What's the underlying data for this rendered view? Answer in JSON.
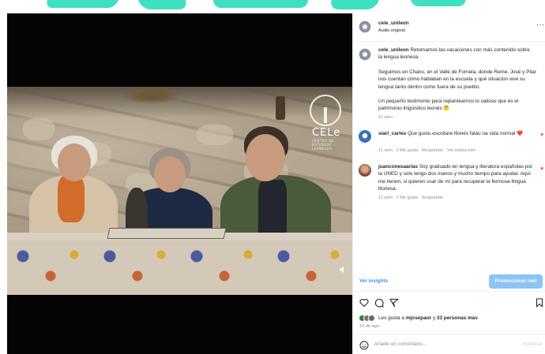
{
  "post": {
    "username": "cele_unileon",
    "audio": "Audio original",
    "caption_user": "cele_unileon",
    "caption_p1": "Retomamos las vacaciones con más contenido sobre la lengua leonesa.",
    "caption_p2": "Seguimos en Chano, en el Valle de Fornela, donde Reme, José y Pilar nos cuentan cómo hablaban en la escuela y qué situación vive su lengua tanto dentro como fuera de su pueblo.",
    "caption_p3": "Un pequeño testimonio para replantearnos lo valioso que es el patrimonio lingüístico leonés 🤔",
    "caption_time": "11 sem"
  },
  "video": {
    "logo_text": "CELe",
    "logo_subtext": "CENTRO DE ESTUDIOS LEONESES"
  },
  "comments": [
    {
      "user": "siarl_carles",
      "text": "Que gustu escoitare llionés falàu na vida normal ❤️",
      "time": "11 sem",
      "likes": "2 Me gusta",
      "reply": "Responder",
      "translate": "Ver traducción"
    },
    {
      "user": "juanconesaarlas",
      "text": "Soy graduado en lengua y literatura españolas por la UNED y solo tengo dos manos y mucho tiempo para ayudar. Aquí me tienen, si quieren usar de mí para recuperar la fermosa llingua llionesa.",
      "time": "11 sem",
      "likes": "2 Me gusta",
      "reply": "Responder"
    }
  ],
  "actions": {
    "insights": "Ver insights",
    "promote": "Promocionar reel"
  },
  "likes": {
    "prefix": "Les gusta a",
    "user": "mjosepaor",
    "connector": "y",
    "others": "33 personas más",
    "date": "19 de ago."
  },
  "comment_bar": {
    "placeholder": "Añade un comentario...",
    "publish": "Publicar"
  },
  "colors": {
    "accent": "#0095f6",
    "promote_button": "#8cc4f5",
    "heart": "#ed4956",
    "background_shapes": "#3fe0c0"
  },
  "icons": [
    "more-icon",
    "heart-icon",
    "comment-icon",
    "share-icon",
    "bookmark-icon",
    "emoji-icon",
    "mute-icon"
  ]
}
